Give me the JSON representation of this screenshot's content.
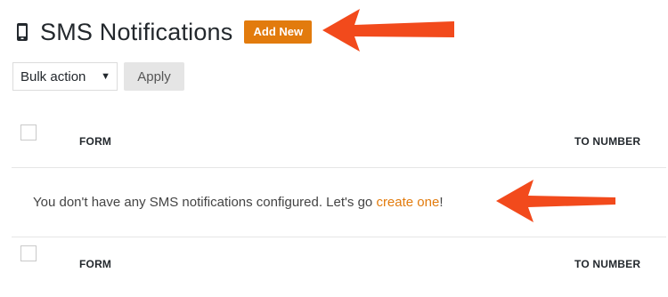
{
  "header": {
    "icon": "phone-icon",
    "title": "SMS Notifications",
    "add_new_label": "Add New"
  },
  "toolbar": {
    "bulk_action_selected": "Bulk action",
    "apply_label": "Apply"
  },
  "table": {
    "columns": [
      "FORM",
      "TO NUMBER"
    ],
    "empty_message": {
      "prefix": "You don't have any SMS notifications configured. Let's go ",
      "link": "create one",
      "suffix": "!"
    },
    "footer_columns": [
      "FORM",
      "TO NUMBER"
    ]
  },
  "colors": {
    "accent": "#e27b0d",
    "annotation_arrow": "#f24a1c",
    "text": "#23282d"
  }
}
